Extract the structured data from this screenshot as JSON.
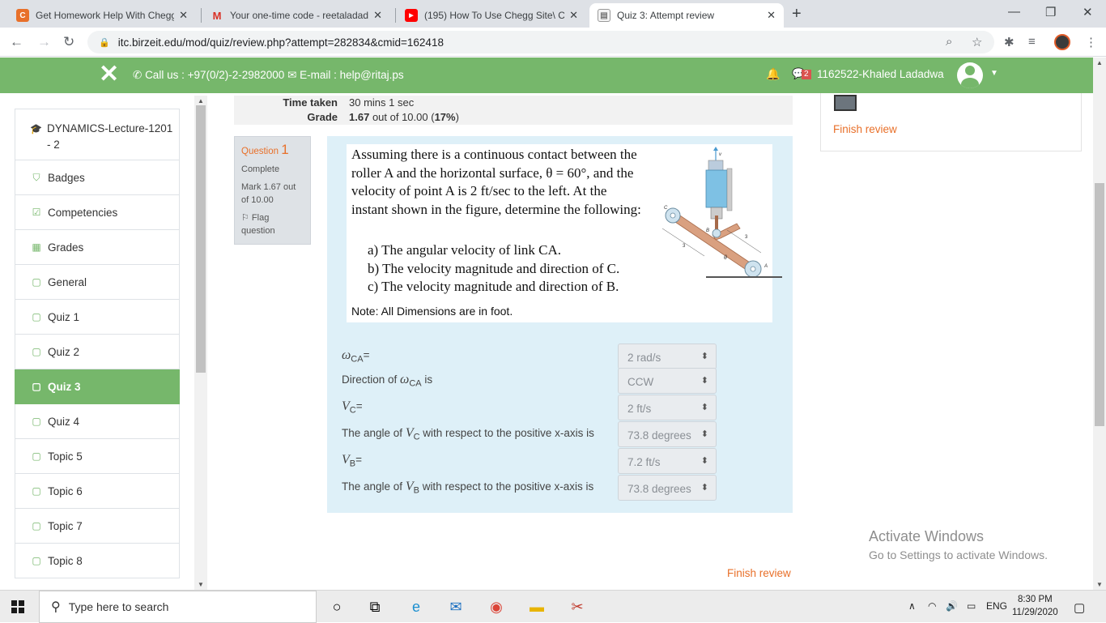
{
  "browser": {
    "tabs": [
      {
        "title": "Get Homework Help With Chegg",
        "favicon": "chegg-icon"
      },
      {
        "title": "Your one-time code - reetaladad",
        "favicon": "gmail-icon"
      },
      {
        "title": "(195) How To Use Chegg Site\\ Ch",
        "favicon": "youtube-icon"
      },
      {
        "title": "Quiz 3: Attempt review",
        "favicon": "moodle-icon"
      }
    ],
    "url": "itc.birzeit.edu/mod/quiz/review.php?attempt=282834&cmid=162418"
  },
  "header": {
    "contact": "Call us : +97(0/2)-2-2982000",
    "email": "E-mail : help@ritaj.ps",
    "msg_count": "2",
    "user_name": "1162522-Khaled Ladadwa"
  },
  "sidebar": {
    "items": [
      {
        "label": "DYNAMICS-Lecture-1201 - 2",
        "icon": "graduation-cap-icon"
      },
      {
        "label": "Badges",
        "icon": "shield-icon"
      },
      {
        "label": "Competencies",
        "icon": "checkbox-icon"
      },
      {
        "label": "Grades",
        "icon": "table-icon"
      },
      {
        "label": "General",
        "icon": "folder-icon"
      },
      {
        "label": "Quiz 1",
        "icon": "folder-icon"
      },
      {
        "label": "Quiz 2",
        "icon": "folder-icon"
      },
      {
        "label": "Quiz 3",
        "icon": "folder-icon"
      },
      {
        "label": "Quiz 4",
        "icon": "folder-icon"
      },
      {
        "label": "Topic 5",
        "icon": "folder-icon"
      },
      {
        "label": "Topic 6",
        "icon": "folder-icon"
      },
      {
        "label": "Topic 7",
        "icon": "folder-icon"
      },
      {
        "label": "Topic 8",
        "icon": "folder-icon"
      }
    ]
  },
  "summary": {
    "time_taken_label": "Time taken",
    "time_taken": "30 mins 1 sec",
    "grade_label": "Grade",
    "grade_score": "1.67",
    "grade_rest": "out of 10.00 (",
    "grade_pct": "17%",
    "grade_close": ")"
  },
  "question": {
    "label": "Question",
    "number": "1",
    "state": "Complete",
    "mark": "Mark 1.67 out of 10.00",
    "flag": "Flag question",
    "text": "Assuming there is a continuous contact between the roller A and the horizontal surface, θ = 60°, and the velocity of point A is 2 ft/sec to the left. At the instant shown in the figure, determine the following:",
    "parts": [
      "a) The angular velocity of link CA.",
      "b) The velocity magnitude and direction of C.",
      "c) The velocity magnitude and direction of B."
    ],
    "note": "Note: All Dimensions are in foot.",
    "figure_labels": {
      "v": "v",
      "c": "C",
      "b": "B",
      "a": "A",
      "d1": "3",
      "d2": "3",
      "theta": "θ"
    },
    "answers": [
      {
        "pre": "",
        "sym": "ω",
        "sub": "CA",
        "post": "=",
        "value": "2 rad/s"
      },
      {
        "pre": "Direction of ",
        "sym": "ω",
        "sub": "CA",
        "post": " is",
        "value": "CCW"
      },
      {
        "pre": "",
        "sym": "V",
        "sub": "C",
        "post": "=",
        "value": "2 ft/s"
      },
      {
        "pre": "The angle of ",
        "sym": "V",
        "sub": "C",
        "post": " with respect to the positive x-axis is",
        "value": "73.8 degrees"
      },
      {
        "pre": "",
        "sym": "V",
        "sub": "B",
        "post": "=",
        "value": "7.2 ft/s"
      },
      {
        "pre": "The angle of ",
        "sym": "V",
        "sub": "B",
        "post": " with respect to the positive x-axis is",
        "value": "73.8 degrees"
      }
    ]
  },
  "finish_review": "Finish review",
  "watermark": {
    "line1": "Activate Windows",
    "line2": "Go to Settings to activate Windows."
  },
  "taskbar": {
    "search_placeholder": "Type here to search",
    "lang": "ENG",
    "time": "8:30 PM",
    "date": "11/29/2020"
  },
  "colors": {
    "accent": "#76b76b",
    "link": "#e8702a",
    "question_bg": "#def0f8"
  }
}
